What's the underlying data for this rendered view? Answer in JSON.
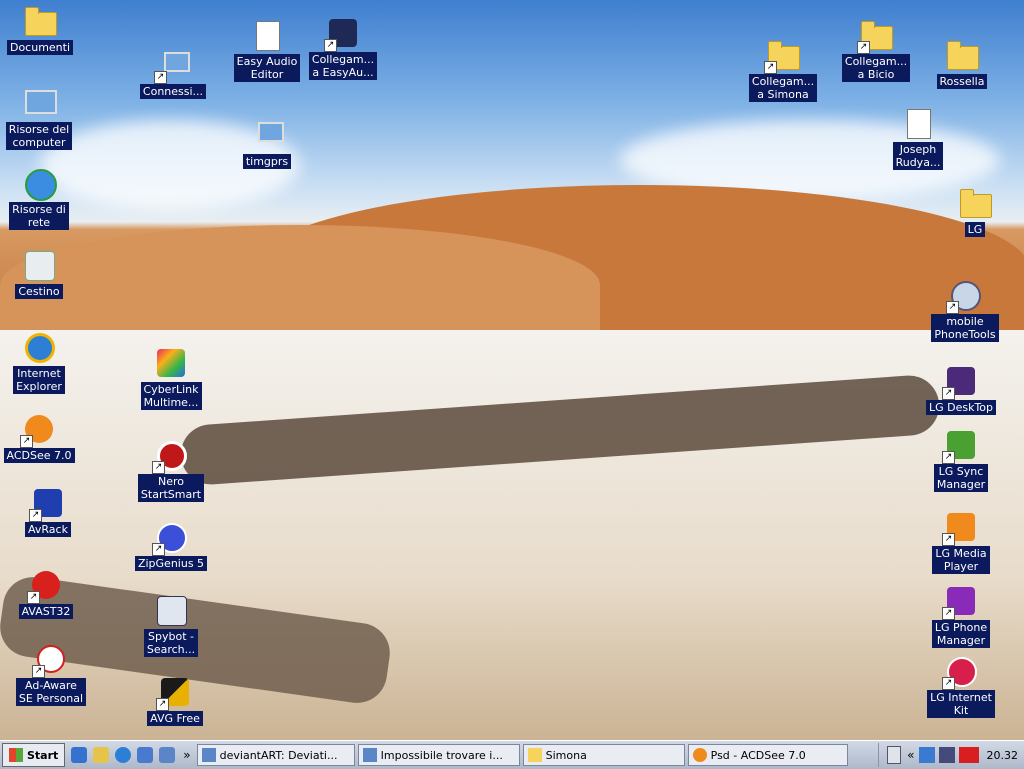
{
  "desktop_icons": {
    "documenti": "Documenti",
    "connessi": "Connessi...",
    "easy_audio_editor": "Easy Audio\nEditor",
    "collegam_easyau": "Collegam...\na EasyAu...",
    "timgprs": "timgprs",
    "risorse_computer": "Risorse del\ncomputer",
    "risorse_rete": "Risorse di\nrete",
    "cestino": "Cestino",
    "internet_explorer": "Internet\nExplorer",
    "cyberlink": "CyberLink\nMultime...",
    "acdsee": "ACDSee 7.0",
    "nero": "Nero\nStartSmart",
    "avrack": "AvRack",
    "zipgenius": "ZipGenius 5",
    "avast": "AVAST32",
    "spybot": "Spybot -\nSearch...",
    "adaware": "Ad-Aware\nSE Personal",
    "avg": "AVG Free",
    "collegam_simona": "Collegam...\na Simona",
    "collegam_bicio": "Collegam...\na Bicio",
    "rossella": "Rossella",
    "joseph": "Joseph\nRudya...",
    "lg": "LG",
    "mobile_phonetools": "mobile\nPhoneTools",
    "lg_desktop": "LG DeskTop",
    "lg_sync": "LG Sync\nManager",
    "lg_media": "LG Media\nPlayer",
    "lg_phone": "LG Phone\nManager",
    "lg_internet": "LG Internet\nKit"
  },
  "taskbar": {
    "start_label": "Start",
    "tasks": [
      "deviantART: Deviati...",
      "Impossibile trovare i...",
      "Simona",
      "Psd - ACDSee 7.0"
    ],
    "chevron": "»",
    "tray_chevron": "«",
    "clock": "20.32"
  },
  "colors": {
    "label_bg": "#0b1a5c",
    "taskbar": "#c3cbdb"
  }
}
